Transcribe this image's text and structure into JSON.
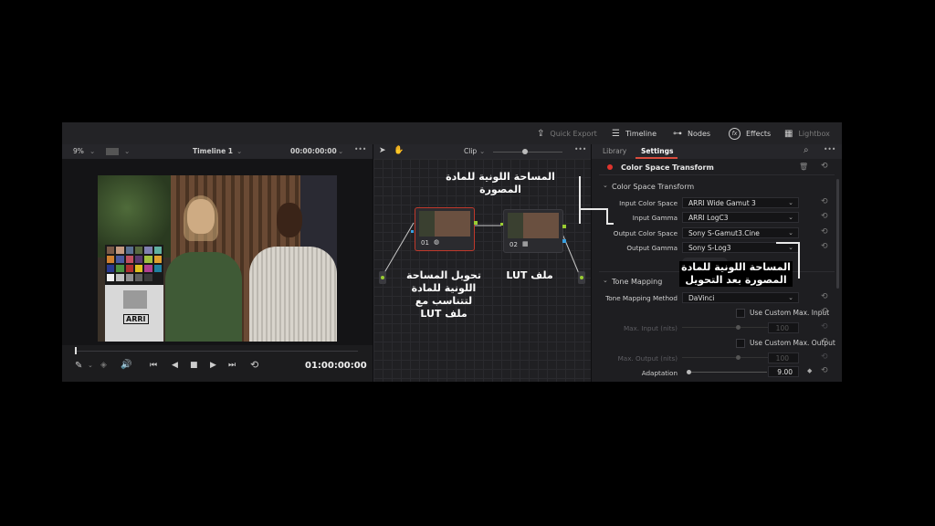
{
  "topbar": {
    "quick_export": "Quick Export",
    "timeline": "Timeline",
    "nodes": "Nodes",
    "effects": "Effects",
    "lightbox": "Lightbox"
  },
  "viewer": {
    "zoom": "9%",
    "timeline_name": "Timeline 1",
    "timecode_top": "00:00:00:00",
    "timecode": "01:00:00:00",
    "chart_brand": "ARRI"
  },
  "node_editor": {
    "clip_label": "Clip",
    "nodes": [
      {
        "id": "01"
      },
      {
        "id": "02"
      }
    ]
  },
  "panel": {
    "tabs": [
      "Library",
      "Settings"
    ],
    "effect_title": "Color Space Transform",
    "section1": "Color Space Transform",
    "rows": [
      {
        "label": "Input Color Space",
        "value": "ARRI Wide Gamut 3"
      },
      {
        "label": "Input Gamma",
        "value": "ARRI LogC3"
      },
      {
        "label": "Output Color Space",
        "value": "Sony S-Gamut3.Cine"
      },
      {
        "label": "Output Gamma",
        "value": "Sony S-Log3"
      }
    ],
    "section2": "Tone Mapping",
    "tone_method_label": "Tone Mapping Method",
    "tone_method_value": "DaVinci",
    "use_custom_input": "Use Custom Max. Input",
    "max_input_label": "Max. Input (nits)",
    "max_input_value": "100",
    "use_custom_output": "Use Custom Max. Output",
    "max_output_label": "Max. Output (nits)",
    "max_output_value": "100",
    "adaptation_label": "Adaptation",
    "adaptation_value": "9.00"
  },
  "annotations": {
    "source_space": "المساحة اللونية للمادة المصورة",
    "output_space_1": "المساحة اللونية للمادة",
    "output_space_2": "المصورة بعد التحويل",
    "node1_1": "تحويل المساحة",
    "node1_2": "اللونية للمادة",
    "node1_3": "لتتناسب مع",
    "node1_4": "ملف LUT",
    "node2": "ملف LUT"
  },
  "colors": {
    "accent": "#e0342d",
    "tab_underline": "#d94c3d"
  }
}
